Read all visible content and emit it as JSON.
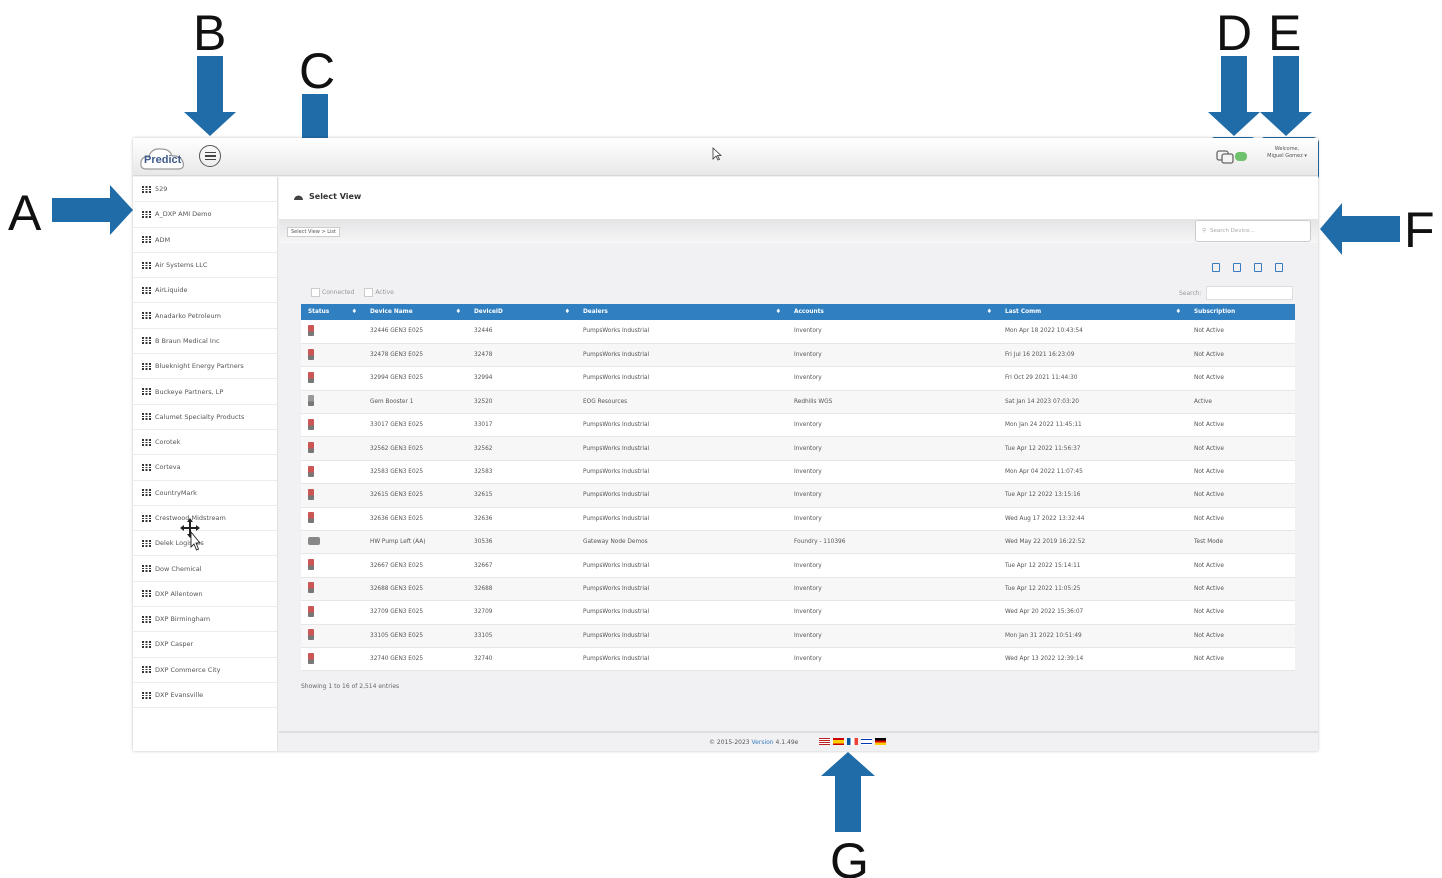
{
  "callouts": [
    "A",
    "B",
    "C",
    "D",
    "E",
    "F",
    "G"
  ],
  "app": {
    "logo_text": "Predict",
    "welcome_line1": "Welcome,",
    "welcome_line2": "Miguel Gomez ▾",
    "select_view_label": "Select View",
    "breadcrumb": "Select View  >  List",
    "search_device_placeholder": "Search Device...",
    "filter_connected": "Connected",
    "filter_active": "Active",
    "table_search_label": "Search:",
    "showing_text": "Showing 1 to 16 of 2,514 entries",
    "footer_copyright": "© 2015-2023",
    "footer_version_label": "Version",
    "footer_version": "4.1.49e"
  },
  "sidebar": {
    "items": [
      "529",
      "A_DXP AMI Demo",
      "ADM",
      "Air Systems LLC",
      "AirLiquide",
      "Anadarko Petroleum",
      "B Braun Medical Inc",
      "Blueknight Energy Partners",
      "Buckeye Partners, LP",
      "Calumet Specialty Products",
      "Corotek",
      "Corteva",
      "CountryMark",
      "Crestwood Midstream",
      "Delek Logistics",
      "Dow Chemical",
      "DXP Allentown",
      "DXP Birmingham",
      "DXP Casper",
      "DXP Commerce City",
      "DXP Evansville"
    ]
  },
  "table": {
    "headers": [
      "Status",
      "Device Name",
      "DeviceID",
      "Dealers",
      "Accounts",
      "Last Comm",
      "Subscription"
    ],
    "rows": [
      {
        "status": "red",
        "name": "32446 GEN3 E025",
        "id": "32446",
        "dealer": "PumpsWorks Industrial",
        "account": "Inventory",
        "last": "Mon Apr 18 2022 10:43:54",
        "sub": "Not Active"
      },
      {
        "status": "red",
        "name": "32478 GEN3 E025",
        "id": "32478",
        "dealer": "PumpsWorks Industrial",
        "account": "Inventory",
        "last": "Fri Jul 16 2021 16:23:09",
        "sub": "Not Active"
      },
      {
        "status": "red",
        "name": "32994 GEN3 E025",
        "id": "32994",
        "dealer": "PumpsWorks Industrial",
        "account": "Inventory",
        "last": "Fri Oct 29 2021 11:44:30",
        "sub": "Not Active"
      },
      {
        "status": "gray-red",
        "name": "Gem Booster 1",
        "id": "32520",
        "dealer": "EOG Resources",
        "account": "Redhills WGS",
        "last": "Sat Jan 14 2023 07:03:20",
        "sub": "Active"
      },
      {
        "status": "red",
        "name": "33017 GEN3 E025",
        "id": "33017",
        "dealer": "PumpsWorks Industrial",
        "account": "Inventory",
        "last": "Mon Jan 24 2022 11:45:11",
        "sub": "Not Active"
      },
      {
        "status": "red",
        "name": "32562 GEN3 E025",
        "id": "32562",
        "dealer": "PumpsWorks Industrial",
        "account": "Inventory",
        "last": "Tue Apr 12 2022 11:56:37",
        "sub": "Not Active"
      },
      {
        "status": "red",
        "name": "32583 GEN3 E025",
        "id": "32583",
        "dealer": "PumpsWorks Industrial",
        "account": "Inventory",
        "last": "Mon Apr 04 2022 11:07:45",
        "sub": "Not Active"
      },
      {
        "status": "red",
        "name": "32615 GEN3 E025",
        "id": "32615",
        "dealer": "PumpsWorks Industrial",
        "account": "Inventory",
        "last": "Tue Apr 12 2022 13:15:16",
        "sub": "Not Active"
      },
      {
        "status": "red",
        "name": "32636 GEN3 E025",
        "id": "32636",
        "dealer": "PumpsWorks Industrial",
        "account": "Inventory",
        "last": "Wed Aug 17 2022 13:32:44",
        "sub": "Not Active"
      },
      {
        "status": "gray",
        "name": "HW Pump Left (AA)",
        "id": "30536",
        "dealer": "Gateway Node Demos",
        "account": "Foundry - 110396",
        "last": "Wed May 22 2019 16:22:52",
        "sub": "Test Mode"
      },
      {
        "status": "red",
        "name": "32667 GEN3 E025",
        "id": "32667",
        "dealer": "PumpsWorks Industrial",
        "account": "Inventory",
        "last": "Tue Apr 12 2022 15:14:11",
        "sub": "Not Active"
      },
      {
        "status": "red",
        "name": "32688 GEN3 E025",
        "id": "32688",
        "dealer": "PumpsWorks Industrial",
        "account": "Inventory",
        "last": "Tue Apr 12 2022 11:05:25",
        "sub": "Not Active"
      },
      {
        "status": "red",
        "name": "32709 GEN3 E025",
        "id": "32709",
        "dealer": "PumpsWorks Industrial",
        "account": "Inventory",
        "last": "Wed Apr 20 2022 15:36:07",
        "sub": "Not Active"
      },
      {
        "status": "red",
        "name": "33105 GEN3 E025",
        "id": "33105",
        "dealer": "PumpsWorks Industrial",
        "account": "Inventory",
        "last": "Mon Jan 31 2022 10:51:49",
        "sub": "Not Active"
      },
      {
        "status": "red",
        "name": "32740 GEN3 E025",
        "id": "32740",
        "dealer": "PumpsWorks Industrial",
        "account": "Inventory",
        "last": "Wed Apr 13 2022 12:39:14",
        "sub": "Not Active"
      }
    ]
  },
  "colors": {
    "callout_blue": "#1f6ca8",
    "table_header": "#2f7fc1",
    "badge_green": "#6ec26e"
  },
  "icons": [
    "menu-icon",
    "messages-icon",
    "search-icon",
    "dashboard-icon",
    "grid-icon",
    "trash-icon",
    "export-icon",
    "print-icon",
    "flag-icon"
  ]
}
